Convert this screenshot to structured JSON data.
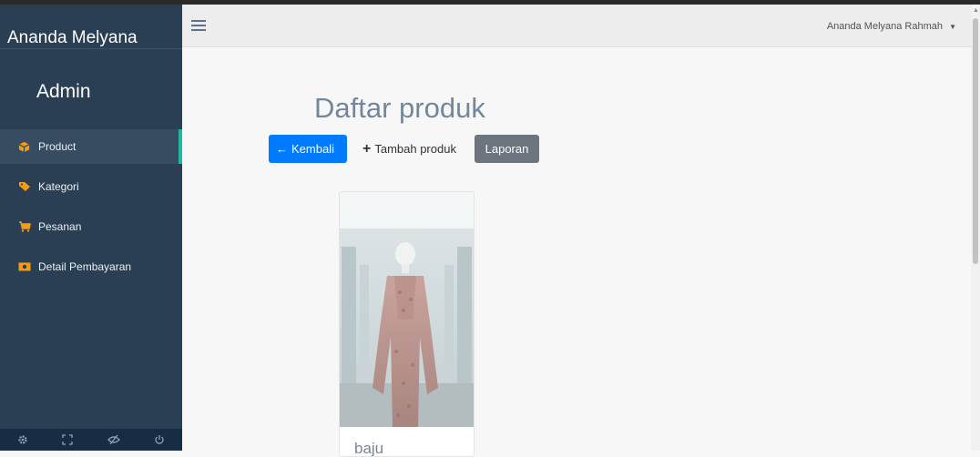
{
  "sidebar": {
    "brand": "Ananda Melyana",
    "role": "Admin",
    "items": [
      {
        "label": "Product",
        "icon": "cube-icon",
        "active": true
      },
      {
        "label": "Kategori",
        "icon": "tags-icon",
        "active": false
      },
      {
        "label": "Pesanan",
        "icon": "cart-icon",
        "active": false
      },
      {
        "label": "Detail Pembayaran",
        "icon": "money-icon",
        "active": false
      }
    ],
    "footer_icons": [
      "gear-icon",
      "fullscreen-icon",
      "eye-slash-icon",
      "power-icon"
    ]
  },
  "topnav": {
    "user_name": "Ananda Melyana Rahmah"
  },
  "main": {
    "title": "Daftar produk",
    "back_label": "Kembali",
    "add_label": "Tambah produk",
    "report_label": "Laporan"
  },
  "products": [
    {
      "name": "baju"
    }
  ],
  "colors": {
    "sidebar": "#2a3f54",
    "accent": "#1abb9c",
    "icon": "#f39c12",
    "primary": "#007bff",
    "secondary": "#6c757d"
  }
}
